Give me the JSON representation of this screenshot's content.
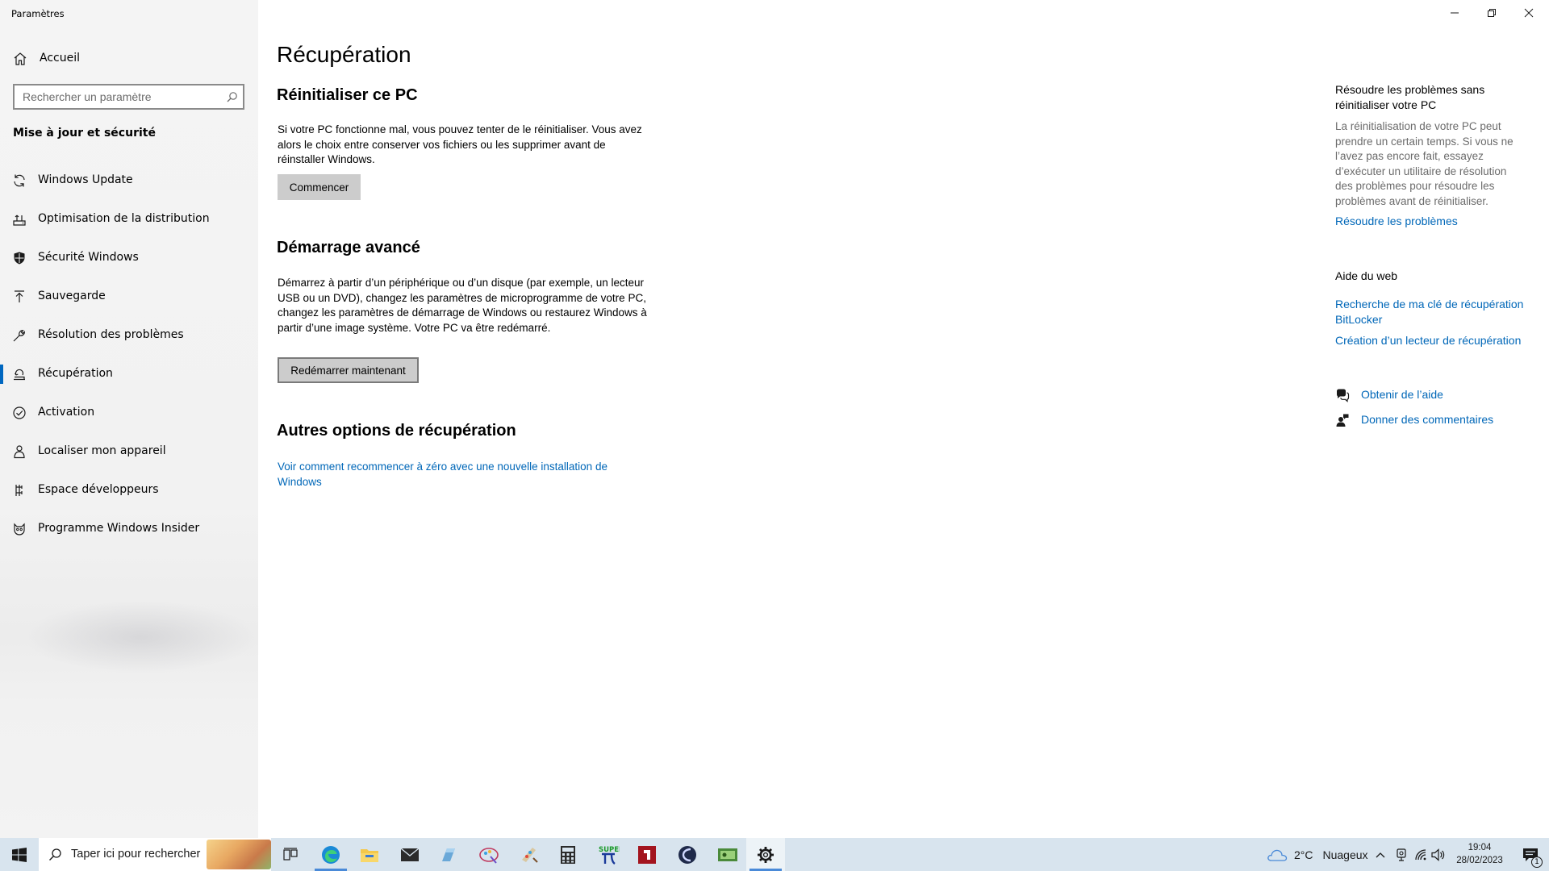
{
  "window": {
    "title": "Paramètres",
    "controls": [
      "minimize",
      "restore",
      "close"
    ]
  },
  "sidebar": {
    "home_label": "Accueil",
    "search_placeholder": "Rechercher un paramètre",
    "section_heading": "Mise à jour et sécurité",
    "items": [
      {
        "label": "Windows Update",
        "icon": "sync-icon"
      },
      {
        "label": "Optimisation de la distribution",
        "icon": "delivery-optimization-icon"
      },
      {
        "label": "Sécurité Windows",
        "icon": "shield-icon"
      },
      {
        "label": "Sauvegarde",
        "icon": "backup-arrow-icon"
      },
      {
        "label": "Résolution des problèmes",
        "icon": "wrench-icon"
      },
      {
        "label": "Récupération",
        "icon": "recovery-icon",
        "active": true
      },
      {
        "label": "Activation",
        "icon": "check-circle-icon"
      },
      {
        "label": "Localiser mon appareil",
        "icon": "find-device-icon"
      },
      {
        "label": "Espace développeurs",
        "icon": "developer-icon"
      },
      {
        "label": "Programme Windows Insider",
        "icon": "insider-cat-icon"
      }
    ]
  },
  "main": {
    "page_title": "Récupération",
    "reset": {
      "heading": "Réinitialiser ce PC",
      "text": "Si votre PC fonctionne mal, vous pouvez tenter de le réinitialiser. Vous avez alors le choix entre conserver vos fichiers ou les supprimer avant de réinstaller Windows.",
      "button": "Commencer"
    },
    "advanced": {
      "heading": "Démarrage avancé",
      "text": "Démarrez à partir d’un périphérique ou d’un disque (par exemple, un lecteur USB ou un DVD), changez les paramètres de microprogramme de votre PC, changez les paramètres de démarrage de Windows ou restaurez Windows à partir d’une image système. Votre PC va être redémarré.",
      "button": "Redémarrer maintenant"
    },
    "other": {
      "heading": "Autres options de récupération",
      "link": "Voir comment recommencer à zéro avec une nouvelle installation de Windows"
    }
  },
  "right": {
    "troubleshoot_heading": "Résoudre les problèmes sans réinitialiser votre PC",
    "troubleshoot_text": "La réinitialisation de votre PC peut prendre un certain temps. Si vous ne l’avez pas encore fait, essayez d’exécuter un utilitaire de résolution des problèmes pour résoudre les problèmes avant de réinitialiser.",
    "troubleshoot_link": "Résoudre les problèmes",
    "web_help_heading": "Aide du web",
    "web_links": [
      "Recherche de ma clé de récupération BitLocker",
      "Création d’un lecteur de récupération"
    ],
    "get_help": "Obtenir de l’aide",
    "feedback": "Donner des commentaires"
  },
  "taskbar": {
    "search_placeholder": "Taper ici pour rechercher",
    "apps": [
      "task-view",
      "edge",
      "file-explorer",
      "mail",
      "app-blue",
      "paint-3d",
      "paint",
      "calculator",
      "super-pi",
      "app-red",
      "cinema-4d",
      "app-green",
      "settings"
    ],
    "weather": "2°C",
    "weather_desc": "Nuageux",
    "time": "19:04",
    "date": "28/02/2023",
    "notification_count": "1"
  },
  "colors": {
    "accent": "#0067c0",
    "link": "#0067b8",
    "sidebar_bg": "#f2f2f2",
    "taskbar_bg": "#d8e4ee",
    "button_bg": "#cccccc"
  }
}
